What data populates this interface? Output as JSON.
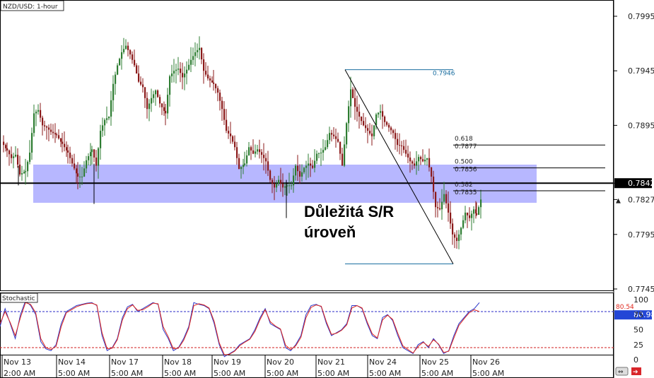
{
  "window": {
    "symbol_label": "NZD/USD: 1-hour",
    "indicator_label": "Stochastic"
  },
  "annotation": {
    "line1": "Důležitá S/R",
    "line2": "úroveň"
  },
  "colors": {
    "up_candle": "#2e7d32",
    "down_candle": "#8b1a1a",
    "sr_zone": "#7b7bff",
    "fib_line": "#1a6ea0",
    "stoch_k": "#2a36c8",
    "stoch_d": "#e0281e",
    "overbought_line": "#2a2ac8",
    "oversold_line": "#d01f1f",
    "current_price_box": "#2346d6"
  },
  "chart_data": [
    {
      "type": "candlestick",
      "symbol": "NZD/USD",
      "timeframe": "1-hour",
      "ylim": [
        0.7725,
        0.8008
      ],
      "y_ticks": [
        "0.7995",
        "0.7945",
        "0.7895",
        "0.7842",
        "0.7827",
        "0.7795",
        "0.7745"
      ],
      "x_labels": [
        "Nov 13",
        "Nov 14",
        "Nov 17",
        "Nov 18",
        "Nov 19",
        "Nov 20",
        "Nov 21",
        "Nov 24",
        "Nov 25",
        "Nov 26"
      ],
      "x_time_labels": [
        "2:00 AM",
        "5:00 AM",
        "5:00 AM",
        "5:00 AM",
        "5:00 AM",
        "5:00 AM",
        "5:00 AM",
        "5:00 AM",
        "5:00 AM",
        "5:00 AM"
      ],
      "close_path": [
        [
          0,
          0.788
        ],
        [
          8,
          0.7872
        ],
        [
          14,
          0.7865
        ],
        [
          20,
          0.7868
        ],
        [
          26,
          0.785
        ],
        [
          34,
          0.7853
        ],
        [
          40,
          0.787
        ],
        [
          46,
          0.7906
        ],
        [
          52,
          0.7909
        ],
        [
          58,
          0.7895
        ],
        [
          64,
          0.7893
        ],
        [
          70,
          0.7889
        ],
        [
          78,
          0.7886
        ],
        [
          86,
          0.7878
        ],
        [
          94,
          0.787
        ],
        [
          100,
          0.786
        ],
        [
          108,
          0.7848
        ],
        [
          114,
          0.7848
        ],
        [
          120,
          0.7863
        ],
        [
          128,
          0.7873
        ],
        [
          134,
          0.7858
        ],
        [
          140,
          0.789
        ],
        [
          146,
          0.79
        ],
        [
          152,
          0.7903
        ],
        [
          158,
          0.7933
        ],
        [
          164,
          0.795
        ],
        [
          170,
          0.7962
        ],
        [
          176,
          0.7968
        ],
        [
          182,
          0.796
        ],
        [
          188,
          0.795
        ],
        [
          194,
          0.7935
        ],
        [
          200,
          0.793
        ],
        [
          206,
          0.791
        ],
        [
          212,
          0.792
        ],
        [
          218,
          0.7927
        ],
        [
          224,
          0.7915
        ],
        [
          232,
          0.7906
        ],
        [
          238,
          0.794
        ],
        [
          244,
          0.7945
        ],
        [
          250,
          0.7947
        ],
        [
          256,
          0.7939
        ],
        [
          262,
          0.7946
        ],
        [
          268,
          0.7955
        ],
        [
          274,
          0.7962
        ],
        [
          280,
          0.7966
        ],
        [
          286,
          0.7945
        ],
        [
          292,
          0.7938
        ],
        [
          300,
          0.7933
        ],
        [
          306,
          0.7925
        ],
        [
          312,
          0.791
        ],
        [
          318,
          0.789
        ],
        [
          324,
          0.7885
        ],
        [
          330,
          0.7875
        ],
        [
          336,
          0.7855
        ],
        [
          344,
          0.786
        ],
        [
          350,
          0.7875
        ],
        [
          356,
          0.7869
        ],
        [
          362,
          0.7873
        ],
        [
          368,
          0.7868
        ],
        [
          374,
          0.7862
        ],
        [
          380,
          0.7845
        ],
        [
          386,
          0.7838
        ],
        [
          392,
          0.7845
        ],
        [
          398,
          0.7838
        ],
        [
          404,
          0.784
        ],
        [
          410,
          0.784
        ],
        [
          416,
          0.7858
        ],
        [
          422,
          0.7848
        ],
        [
          428,
          0.7856
        ],
        [
          434,
          0.786
        ],
        [
          440,
          0.7856
        ],
        [
          446,
          0.7869
        ],
        [
          452,
          0.787
        ],
        [
          458,
          0.7875
        ],
        [
          464,
          0.7888
        ],
        [
          470,
          0.7885
        ],
        [
          476,
          0.788
        ],
        [
          482,
          0.7858
        ],
        [
          488,
          0.7897
        ],
        [
          494,
          0.7928
        ],
        [
          500,
          0.7912
        ],
        [
          506,
          0.7903
        ],
        [
          512,
          0.7895
        ],
        [
          518,
          0.789
        ],
        [
          524,
          0.7885
        ],
        [
          530,
          0.7905
        ],
        [
          536,
          0.7908
        ],
        [
          542,
          0.7898
        ],
        [
          548,
          0.7893
        ],
        [
          554,
          0.7888
        ],
        [
          560,
          0.7877
        ],
        [
          566,
          0.7876
        ],
        [
          572,
          0.7869
        ],
        [
          578,
          0.7862
        ],
        [
          584,
          0.7858
        ],
        [
          590,
          0.7866
        ],
        [
          596,
          0.7862
        ],
        [
          602,
          0.7865
        ],
        [
          608,
          0.7848
        ],
        [
          614,
          0.782
        ],
        [
          620,
          0.7818
        ],
        [
          626,
          0.7832
        ],
        [
          632,
          0.7815
        ],
        [
          638,
          0.7795
        ],
        [
          644,
          0.7789
        ],
        [
          650,
          0.7801
        ],
        [
          656,
          0.7815
        ],
        [
          662,
          0.781
        ],
        [
          668,
          0.7818
        ],
        [
          672,
          0.7813
        ],
        [
          678,
          0.7827
        ]
      ],
      "support_resistance_zone": {
        "label": "Důležitá S/R úroveň",
        "top": 0.7859,
        "bottom": 0.7824,
        "line": 0.7842
      },
      "fibonacci": {
        "swing_high": 0.7946,
        "swing_low": 0.7768,
        "levels": [
          {
            "ratio": "0.618",
            "price": "0.7877"
          },
          {
            "ratio": "0.500",
            "price": "0.7856"
          },
          {
            "ratio": "0.382",
            "price": "0.7835"
          }
        ],
        "high_label": "0.7946"
      },
      "current_price": "0.7827",
      "marked_level": "0.7842"
    },
    {
      "type": "line",
      "title": "Stochastic",
      "ylim": [
        0,
        100
      ],
      "y_ticks": [
        "100",
        "80.98",
        "75",
        "50",
        "25",
        "0"
      ],
      "overbought": 80,
      "oversold": 20,
      "current_k": "80.98",
      "current_d": "80.54",
      "series": [
        {
          "name": "%K",
          "values": [
            55,
            85,
            60,
            35,
            75,
            98,
            90,
            75,
            30,
            18,
            15,
            25,
            60,
            80,
            85,
            90,
            92,
            94,
            95,
            90,
            40,
            15,
            20,
            35,
            70,
            88,
            92,
            80,
            85,
            90,
            95,
            92,
            50,
            35,
            15,
            20,
            35,
            55,
            95,
            92,
            90,
            85,
            60,
            25,
            5,
            10,
            15,
            25,
            30,
            35,
            50,
            70,
            85,
            60,
            55,
            50,
            20,
            15,
            25,
            40,
            75,
            90,
            92,
            88,
            60,
            40,
            45,
            50,
            60,
            90,
            90,
            85,
            60,
            40,
            35,
            70,
            75,
            65,
            40,
            20,
            15,
            10,
            25,
            30,
            20,
            35,
            25,
            10,
            15,
            40,
            60,
            70,
            80,
            85,
            95
          ]
        },
        {
          "values": [
            60,
            80,
            62,
            40,
            70,
            95,
            92,
            78,
            35,
            20,
            17,
            22,
            55,
            78,
            83,
            88,
            91,
            93,
            94,
            91,
            45,
            18,
            19,
            33,
            66,
            85,
            91,
            82,
            83,
            88,
            94,
            93,
            55,
            38,
            18,
            19,
            32,
            52,
            90,
            93,
            91,
            86,
            64,
            28,
            8,
            9,
            14,
            23,
            29,
            34,
            47,
            67,
            83,
            63,
            56,
            51,
            24,
            17,
            23,
            37,
            70,
            87,
            91,
            89,
            63,
            42,
            44,
            49,
            58,
            86,
            90,
            86,
            63,
            43,
            36,
            66,
            74,
            67,
            44,
            23,
            17,
            11,
            22,
            29,
            22,
            33,
            26,
            12,
            14,
            36,
            57,
            68,
            78,
            83,
            80
          ]
        }
      ]
    }
  ]
}
